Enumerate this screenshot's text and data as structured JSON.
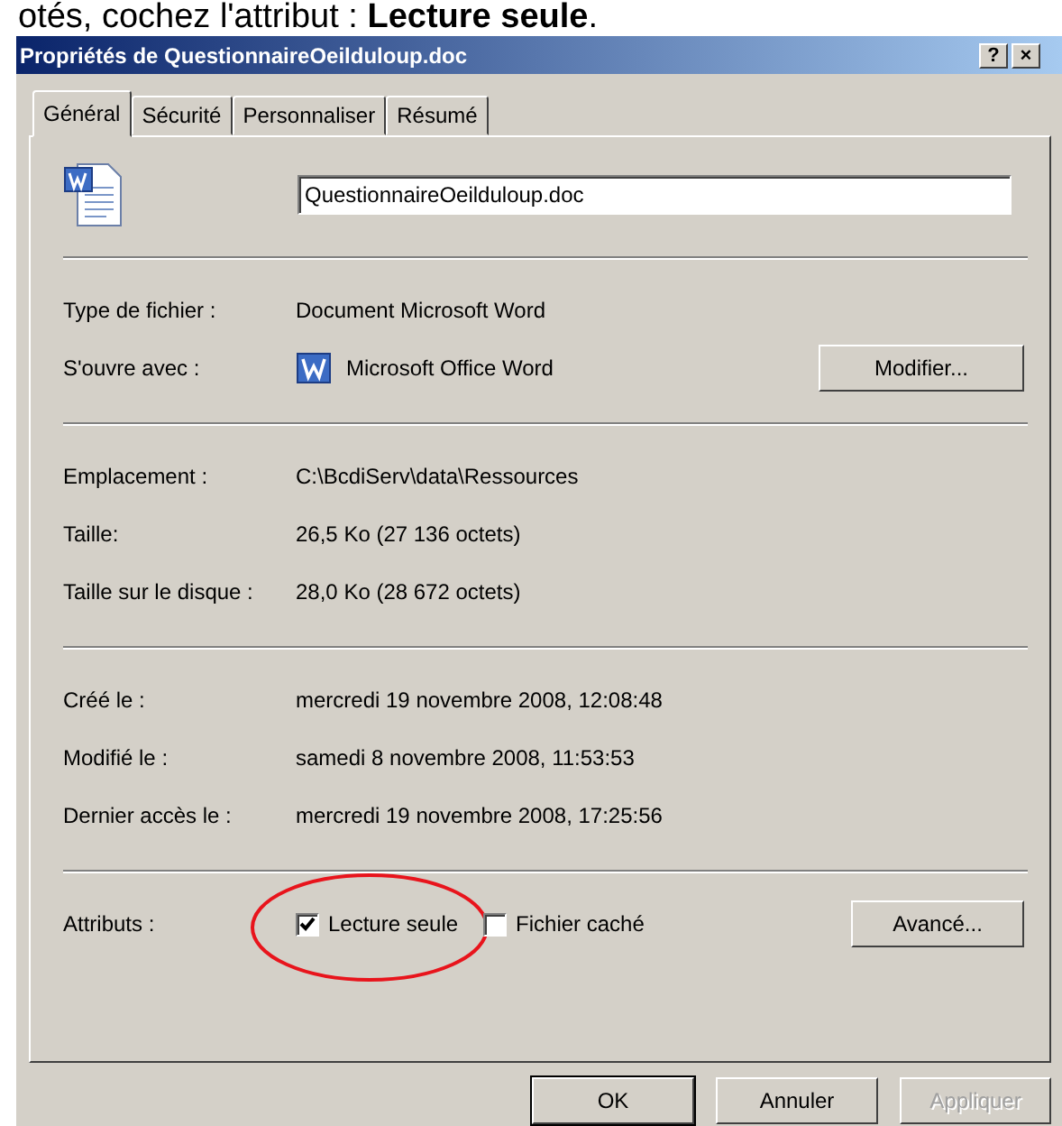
{
  "caption": "otés, cochez l'attribut : **Lecture seule**.",
  "window": {
    "title": "Propriétés de QuestionnaireOeilduloup.doc",
    "title_buttons": [
      "?",
      "×"
    ]
  },
  "tabs": [
    {
      "label": "Général",
      "selected": true
    },
    {
      "label": "Sécurité",
      "selected": false
    },
    {
      "label": "Personnaliser",
      "selected": false
    },
    {
      "label": "Résumé",
      "selected": false
    }
  ],
  "file_name": "QuestionnaireOeilduloup.doc",
  "sections": [
    [
      {
        "label": "Type de fichier :",
        "value": "Document Microsoft Word"
      },
      {
        "label": "S'ouvre avec :",
        "value": "Microsoft Office Word",
        "app_icon": true,
        "button": "Modifier..."
      }
    ],
    [
      {
        "label": "Emplacement :",
        "value": "C:\\BcdiServ\\data\\Ressources"
      },
      {
        "label": "Taille:",
        "value": "26,5 Ko (27 136 octets)"
      },
      {
        "label": "Taille sur le disque :",
        "value": "28,0 Ko (28 672 octets)"
      }
    ],
    [
      {
        "label": "Créé le :",
        "value": "mercredi 19 novembre 2008, 12:08:48"
      },
      {
        "label": "Modifié le :",
        "value": "samedi 8 novembre 2008, 11:53:53"
      },
      {
        "label": "Dernier accès le :",
        "value": "mercredi 19 novembre 2008, 17:25:56"
      }
    ]
  ],
  "attributes": {
    "label": "Attributs :",
    "options": [
      {
        "label": "Lecture seule",
        "checked": true,
        "circled": true
      },
      {
        "label": "Fichier caché",
        "checked": false,
        "circled": false
      }
    ],
    "button": "Avancé..."
  },
  "buttons": [
    {
      "label": "OK",
      "disabled": false,
      "default": true
    },
    {
      "label": "Annuler",
      "disabled": false,
      "default": false
    },
    {
      "label": "Appliquer",
      "disabled": true,
      "default": false
    }
  ]
}
